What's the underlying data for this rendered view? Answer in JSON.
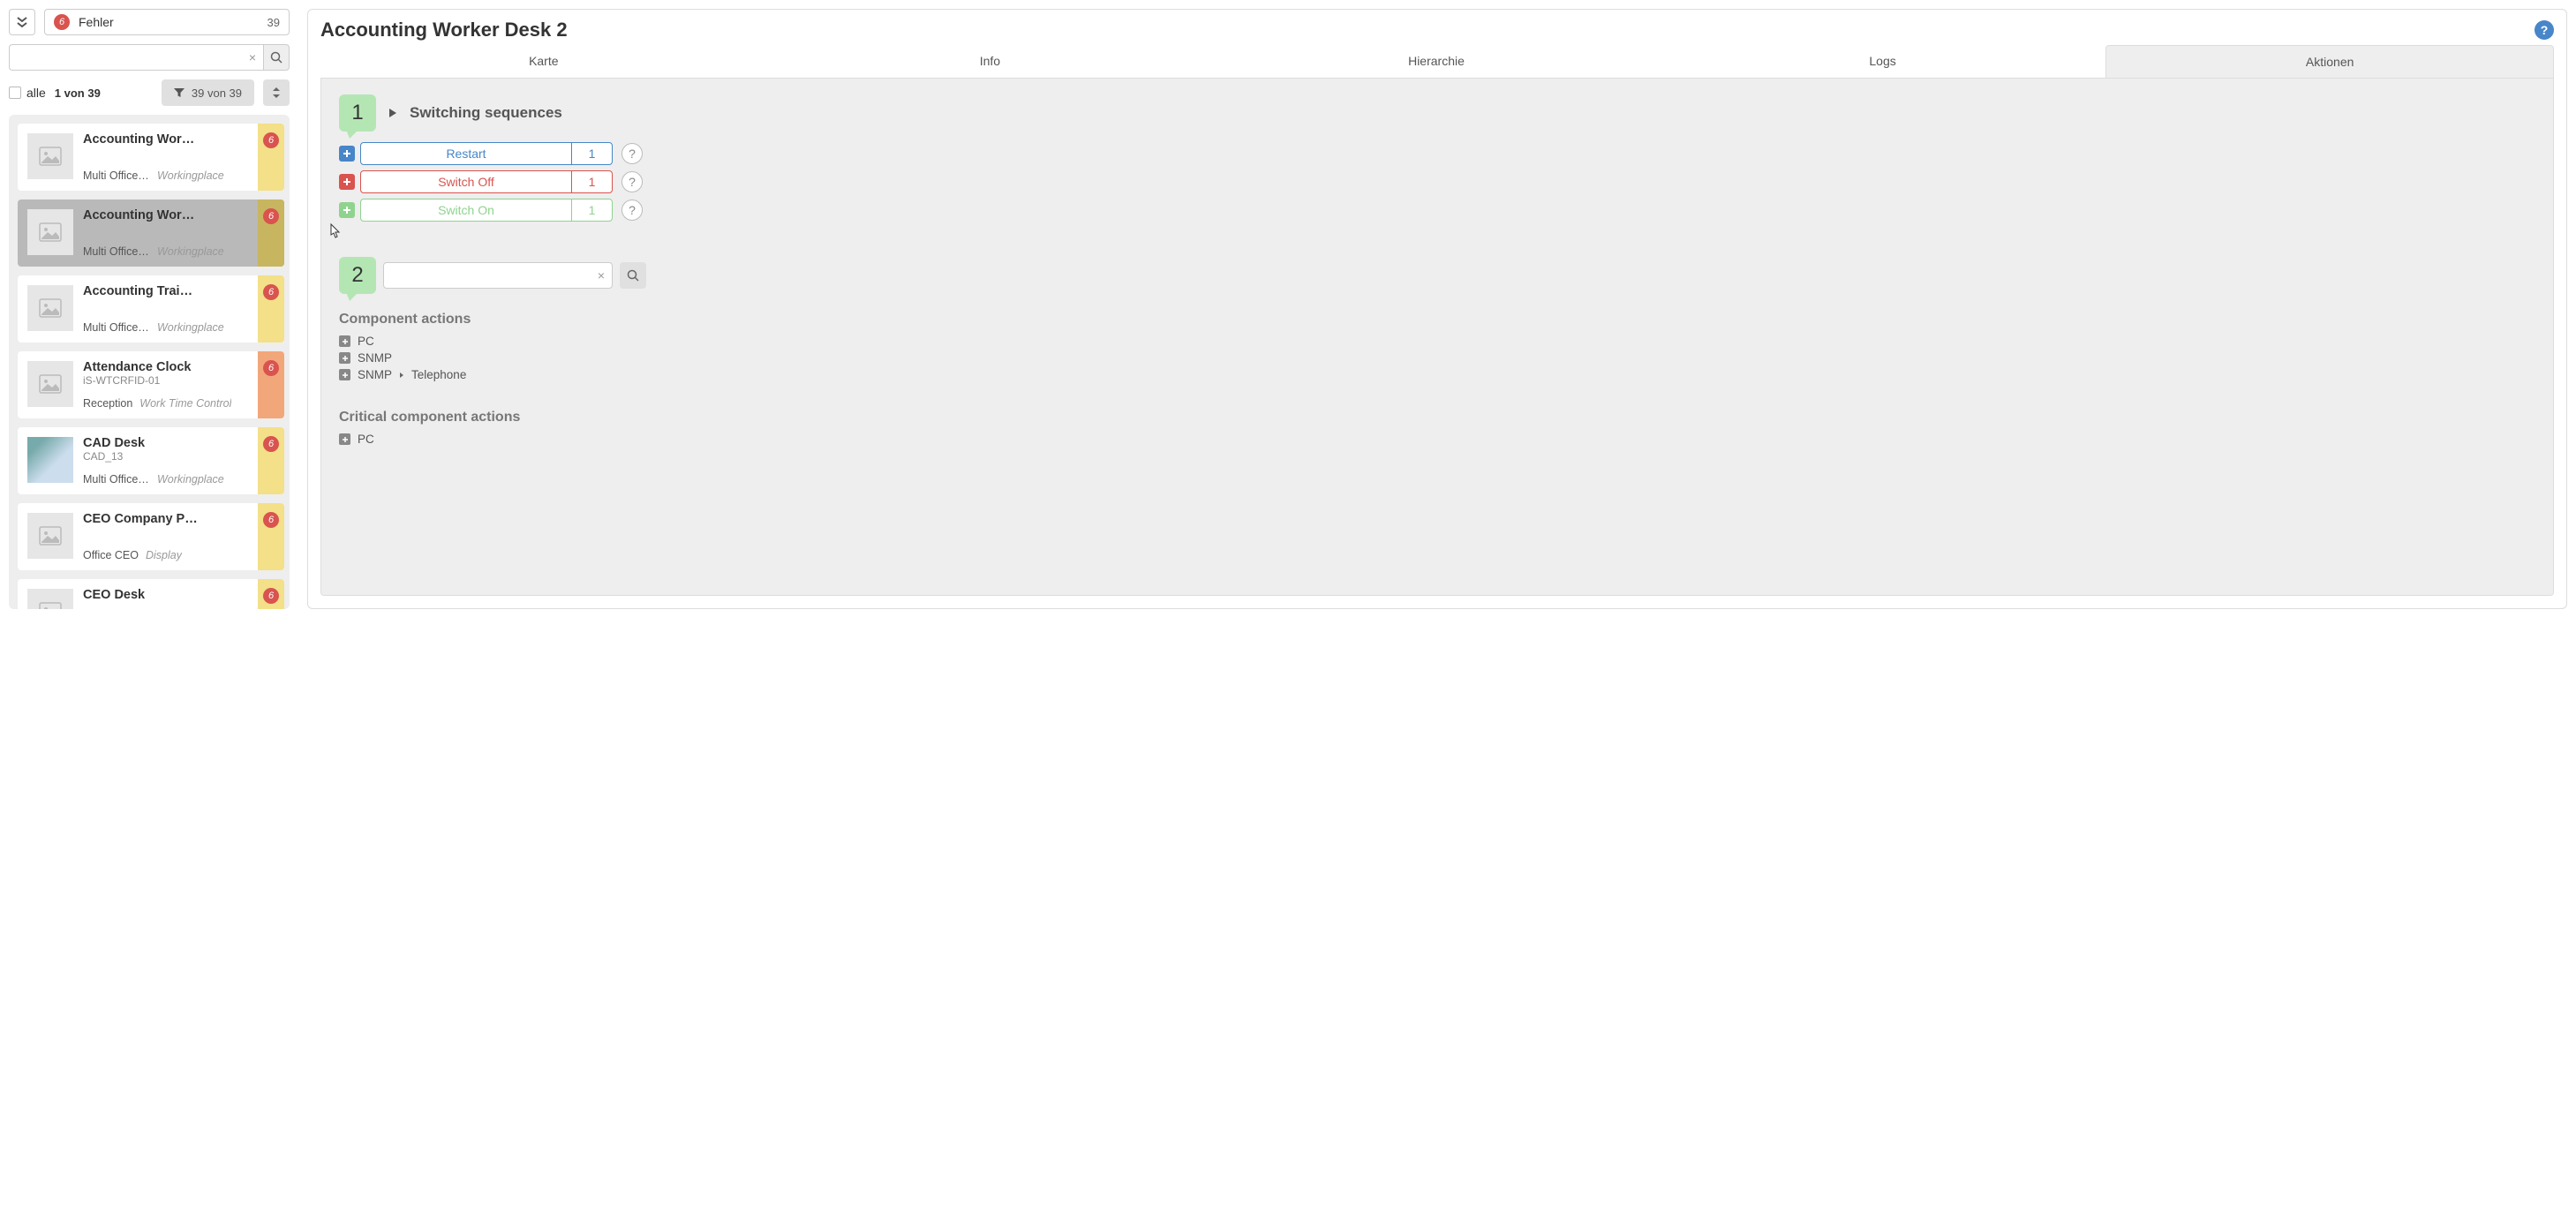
{
  "header": {
    "category_badge": "6",
    "category_label": "Fehler",
    "category_count": "39"
  },
  "filter": {
    "alle": "alle",
    "pager": "1 von 39",
    "filter_label": "39 von 39"
  },
  "list": [
    {
      "title": "Accounting Worker …",
      "sub": "",
      "loc": "Multi Office U…",
      "type": "Workingplace",
      "badge": "6",
      "stripe": "yellow",
      "thumb": "placeholder"
    },
    {
      "title": "Accounting Worker …",
      "sub": "",
      "loc": "Multi Office U…",
      "type": "Workingplace",
      "badge": "6",
      "stripe": "yellow-dark",
      "thumb": "placeholder",
      "selected": true
    },
    {
      "title": "Accounting Trainees …",
      "sub": "",
      "loc": "Multi Office U…",
      "type": "Workingplace",
      "badge": "6",
      "stripe": "yellow",
      "thumb": "placeholder"
    },
    {
      "title": "Attendance Clock",
      "sub": "iS-WTCRFID-01",
      "loc": "Reception",
      "type": "Work Time Control",
      "badge": "6",
      "stripe": "orange",
      "thumb": "placeholder"
    },
    {
      "title": "CAD Desk",
      "sub": "CAD_13",
      "loc": "Multi Office G…",
      "type": "Workingplace",
      "badge": "6",
      "stripe": "yellow",
      "thumb": "photo"
    },
    {
      "title": "CEO Company Proce…",
      "sub": "",
      "loc": "Office CEO",
      "type": "Display",
      "badge": "6",
      "stripe": "yellow",
      "thumb": "placeholder"
    },
    {
      "title": "CEO Desk",
      "sub": "",
      "loc": "",
      "type": "",
      "badge": "6",
      "stripe": "yellow",
      "thumb": "placeholder"
    }
  ],
  "main": {
    "title": "Accounting Worker Desk 2",
    "tabs": [
      "Karte",
      "Info",
      "Hierarchie",
      "Logs",
      "Aktionen"
    ],
    "active_tab": 4,
    "callout1": "1",
    "callout2": "2",
    "switching_title": "Switching sequences",
    "actions": [
      {
        "label": "Restart",
        "count": "1",
        "color": "blue"
      },
      {
        "label": "Switch Off",
        "count": "1",
        "color": "red"
      },
      {
        "label": "Switch On",
        "count": "1",
        "color": "green"
      }
    ],
    "help_q": "?",
    "component_title": "Component actions",
    "components": [
      {
        "label": "PC"
      },
      {
        "label": "SNMP"
      },
      {
        "label_a": "SNMP",
        "label_b": "Telephone"
      }
    ],
    "critical_title": "Critical component actions",
    "critical": [
      {
        "label": "PC"
      }
    ]
  }
}
